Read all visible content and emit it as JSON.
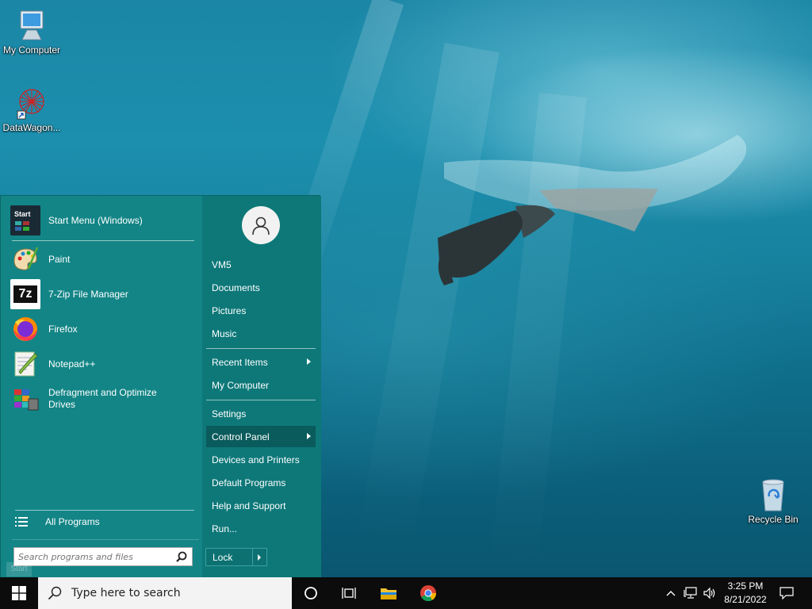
{
  "desktop": {
    "icons": [
      {
        "label": "My Computer",
        "icon": "computer-icon"
      },
      {
        "label": "DataWagon...",
        "icon": "datawagon-icon"
      },
      {
        "label": "Recycle Bin",
        "icon": "recycle-bin-icon"
      }
    ]
  },
  "start_menu": {
    "pinned": [
      {
        "label": "Start Menu (Windows)",
        "icon": "start-menu-icon"
      },
      {
        "label": "Paint",
        "icon": "paint-icon"
      },
      {
        "label": "7-Zip File Manager",
        "icon": "7zip-icon"
      },
      {
        "label": "Firefox",
        "icon": "firefox-icon"
      },
      {
        "label": "Notepad++",
        "icon": "notepadpp-icon"
      },
      {
        "label": "Defragment and Optimize Drives",
        "icon": "defrag-icon"
      }
    ],
    "start_icon_text": "Start",
    "seven_zip_icon_text": "7z",
    "all_programs": "All Programs",
    "search_placeholder": "Search programs and files",
    "right": {
      "user": "VM5",
      "documents": "Documents",
      "pictures": "Pictures",
      "music": "Music",
      "recent_items": "Recent Items",
      "my_computer": "My Computer",
      "settings": "Settings",
      "control_panel": "Control Panel",
      "devices_printers": "Devices and Printers",
      "default_programs": "Default Programs",
      "help_support": "Help and Support",
      "run": "Run...",
      "lock": "Lock"
    }
  },
  "taskbar": {
    "search_text": "Type here to search",
    "time": "3:25 PM",
    "date": "8/21/2022",
    "start_tip": "Start"
  },
  "colors": {
    "menu_left": "#138586",
    "menu_right": "#0e7879",
    "active_item": "#0a5b5c",
    "taskbar": "#0c0c0c"
  }
}
